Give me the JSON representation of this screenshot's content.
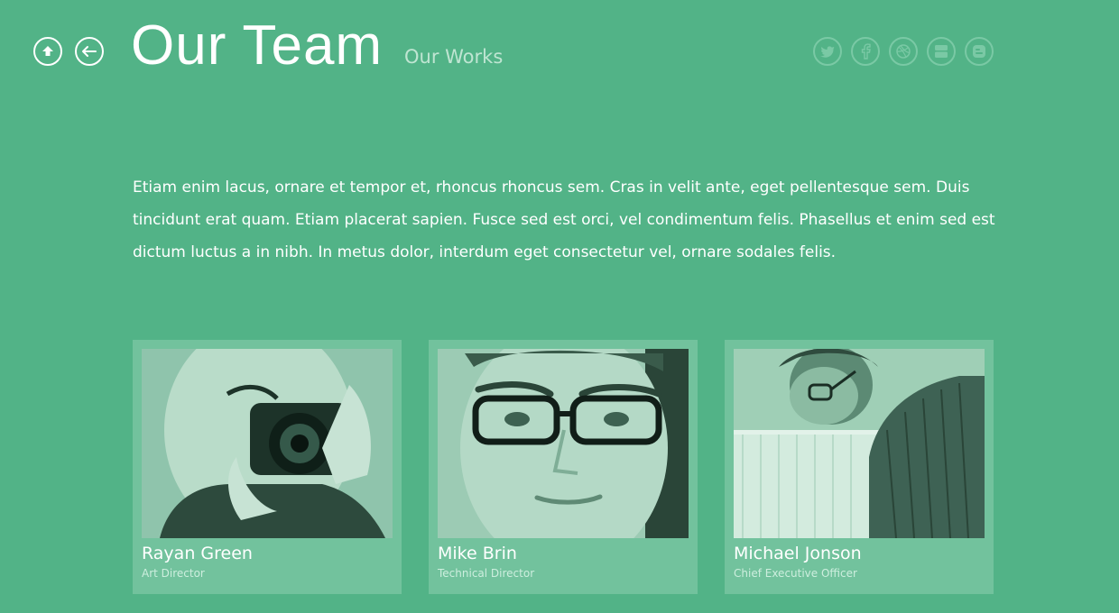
{
  "header": {
    "title": "Our Team",
    "section_link": "Our Works"
  },
  "nav": {
    "up_icon": "arrow-up-circle-icon",
    "back_icon": "arrow-left-circle-icon"
  },
  "social": [
    {
      "name": "twitter",
      "icon": "twitter-icon"
    },
    {
      "name": "facebook",
      "icon": "facebook-icon"
    },
    {
      "name": "dribbble",
      "icon": "dribbble-icon"
    },
    {
      "name": "youtube",
      "icon": "youtube-icon"
    },
    {
      "name": "blogger",
      "icon": "blogger-icon"
    }
  ],
  "intro": "Etiam enim lacus, ornare et tempor et, rhoncus rhoncus sem. Cras in velit ante, eget pellentesque sem. Duis tincidunt erat quam. Etiam placerat sapien. Fusce sed est orci, vel condimentum felis. Phasellus et enim sed est dictum luctus a in nibh. In metus dolor, interdum eget consectetur vel, ornare sodales felis.",
  "team": [
    {
      "name": "Rayan Green",
      "role": "Art Director"
    },
    {
      "name": "Mike Brin",
      "role": "Technical Director"
    },
    {
      "name": "Michael Jonson",
      "role": "Chief Executive Officer"
    }
  ],
  "colors": {
    "background": "#52b387",
    "card": "#72c29d",
    "photo_tint_dark": "#1f3d31",
    "photo_tint_light": "#d8f0e4"
  }
}
